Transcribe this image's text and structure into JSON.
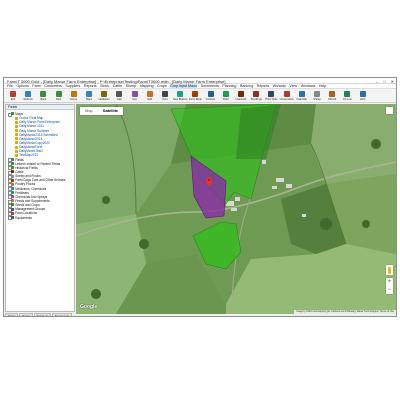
{
  "window": {
    "title": "FarmIT 3000 Gold - [Daily Manor Farm Enterprise] - P:\\Entreprise\\Testing\\FarmIT3000.mdb - [Daily Manor Farm Enterprise]",
    "controls": [
      "–",
      "□",
      "✕"
    ]
  },
  "menu": [
    "File",
    "Options",
    "Farm",
    "Customers",
    "Suppliers",
    "Reports",
    "Stock",
    "Cattle",
    "Sheep",
    "Mapping",
    "Crops",
    "Crop Input Manu",
    "Documents",
    "Planning",
    "Banking",
    "Reports",
    "Wizards",
    "View",
    "Windows",
    "Help"
  ],
  "menu_selected_index": 11,
  "toolbar": [
    {
      "label": "Exit",
      "icon": "exit-icon",
      "color": "#c0392b"
    },
    {
      "label": "Refresh",
      "icon": "refresh-icon",
      "color": "#2e86c1"
    },
    {
      "label": "Back",
      "icon": "back-icon",
      "color": "#3a8f3a"
    },
    {
      "label": "Next",
      "icon": "next-icon",
      "color": "#3a8f3a"
    },
    {
      "label": "Home",
      "icon": "home-icon",
      "color": "#b9770e"
    },
    {
      "label": "Maps",
      "icon": "map-icon",
      "color": "#2e86c1"
    },
    {
      "label": "Hardware",
      "icon": "hardware-icon",
      "color": "#7d6608"
    },
    {
      "label": "Calc",
      "icon": "calculator-icon",
      "color": "#555555"
    },
    {
      "label": "Sort",
      "icon": "sort-icon",
      "color": "#884ea0"
    },
    {
      "label": "Edit",
      "icon": "edit-icon",
      "color": "#ca6f1e"
    },
    {
      "label": "Print",
      "icon": "print-icon",
      "color": "#444444"
    },
    {
      "label": "New Buttons",
      "icon": "buttons-icon",
      "color": "#17a589"
    },
    {
      "label": "Farm Book",
      "icon": "book-icon",
      "color": "#a04000"
    },
    {
      "label": "Crosses",
      "icon": "crosses-icon",
      "color": "#1f618d"
    },
    {
      "label": "Field",
      "icon": "field-icon",
      "color": "#229954"
    },
    {
      "label": "Livestock",
      "icon": "livestock-icon",
      "color": "#6e2c00"
    },
    {
      "label": "Stockings",
      "icon": "stockings-icon",
      "color": "#922b21"
    },
    {
      "label": "Print Ticks",
      "icon": "ticks-icon",
      "color": "#34495e"
    },
    {
      "label": "Crossmatch",
      "icon": "crossmatch-icon",
      "color": "#b03a2e"
    },
    {
      "label": "Calendar",
      "icon": "calendar-icon",
      "color": "#2874a6"
    },
    {
      "label": "Sheep",
      "icon": "sheep-icon",
      "color": "#7f8c8d"
    },
    {
      "label": "Wizard",
      "icon": "wizard-icon",
      "color": "#af601a"
    },
    {
      "label": "On Line",
      "icon": "online-icon",
      "color": "#1e8449"
    },
    {
      "label": "Help",
      "icon": "help-icon",
      "color": "#2471a3"
    }
  ],
  "sidebar": {
    "header": "Fields",
    "tree": [
      {
        "label": "Maps",
        "level": 0,
        "color": "#3a8f3a",
        "toggle": true
      },
      {
        "label": "Guess Field Map",
        "level": 1,
        "color": "#d4ac0d",
        "toggle": false
      },
      {
        "label": "Daily Manor Farm Enterprise",
        "level": 1,
        "color": "#d4ac0d",
        "toggle": false
      },
      {
        "label": "Daily Manor 2011",
        "level": 1,
        "color": "#d4ac0d",
        "toggle": false
      },
      {
        "label": "Daily Manor Summer",
        "level": 1,
        "color": "#d4ac0d",
        "toggle": false
      },
      {
        "label": "DailyManor2013 Submitted",
        "level": 1,
        "color": "#d4ac0d",
        "toggle": false
      },
      {
        "label": "DailyManor2014",
        "level": 1,
        "color": "#d4ac0d",
        "toggle": false
      },
      {
        "label": "DailyManorCopy2020",
        "level": 1,
        "color": "#d4ac0d",
        "toggle": false
      },
      {
        "label": "DailyManorField",
        "level": 1,
        "color": "#d4ac0d",
        "toggle": false
      },
      {
        "label": "DailyManorTest2",
        "level": 1,
        "color": "#d4ac0d",
        "toggle": false
      },
      {
        "label": "TestMap2021",
        "level": 1,
        "color": "#d4ac0d",
        "toggle": false
      },
      {
        "label": "Fields",
        "level": 0,
        "color": "#3a8f3a",
        "toggle": true
      },
      {
        "label": "Linked Leased or Rented Fields",
        "level": 0,
        "color": "#3a8f3a",
        "toggle": true
      },
      {
        "label": "Historical Fields",
        "level": 0,
        "color": "#3a8f3a",
        "toggle": true
      },
      {
        "label": "Cattle",
        "level": 0,
        "color": "#6e2c00",
        "toggle": true
      },
      {
        "label": "Sheep and Flocks",
        "level": 0,
        "color": "#7f8c8d",
        "toggle": true
      },
      {
        "label": "Farm Dogs Cats and Other Animals",
        "level": 0,
        "color": "#a04000",
        "toggle": true
      },
      {
        "label": "Poultry Flocks",
        "level": 0,
        "color": "#b9770e",
        "toggle": true
      },
      {
        "label": "Medicines, Chemicals",
        "level": 0,
        "color": "#2e86c1",
        "toggle": true
      },
      {
        "label": "Fertilisers",
        "level": 0,
        "color": "#229954",
        "toggle": true
      },
      {
        "label": "Chemicals And Sprays",
        "level": 0,
        "color": "#884ea0",
        "toggle": true
      },
      {
        "label": "Feeds and Supplements",
        "level": 0,
        "color": "#ca6f1e",
        "toggle": true
      },
      {
        "label": "Seeds and Crops",
        "level": 0,
        "color": "#3a8f3a",
        "toggle": true
      },
      {
        "label": "Management Groups",
        "level": 0,
        "color": "#1f618d",
        "toggle": true
      },
      {
        "label": "Farm Locations",
        "level": 0,
        "color": "#b03a2e",
        "toggle": true
      },
      {
        "label": "Equipments",
        "level": 0,
        "color": "#555555",
        "toggle": true
      }
    ]
  },
  "bottom_tabs": [
    "Ticket",
    "Setup",
    "Field List",
    "Documents"
  ],
  "map": {
    "tabs": [
      "Map",
      "Satellite"
    ],
    "active_tab": "Satellite",
    "attribution": "Imagery ©2021 Getmapping plc, Infoterra Ltd & Bluesky, Maxar Technologies | Terms of Use",
    "google_label": "Google",
    "zoom_in": "+",
    "zoom_out": "−",
    "field_colors": {
      "green_field": "#2fbf1a",
      "selected_field": "#8a2aa8",
      "marker": "#e8322d"
    }
  }
}
